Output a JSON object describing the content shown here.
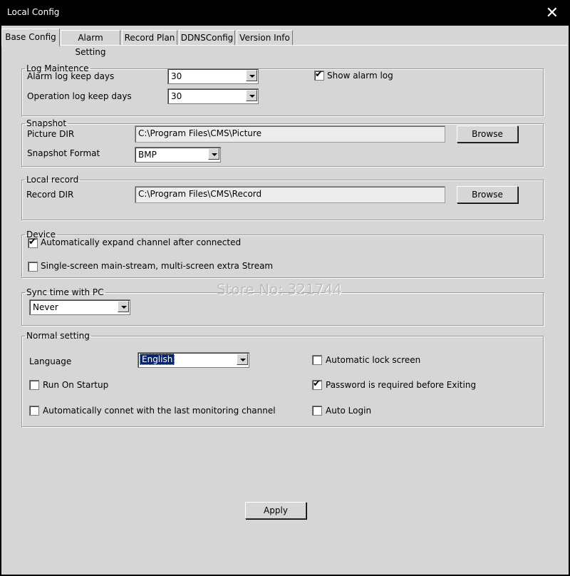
{
  "window": {
    "title": "Local Config",
    "close_label": "✕"
  },
  "tabs": [
    {
      "label": "Base Config"
    },
    {
      "label": "Alarm Setting"
    },
    {
      "label": "Record Plan"
    },
    {
      "label": "DDNSConfig"
    },
    {
      "label": "Version Info"
    }
  ],
  "log": {
    "legend": "Log Maintence",
    "alarm_days_label": "Alarm log keep days",
    "alarm_days_value": "30",
    "op_days_label": "Operation log keep days",
    "op_days_value": "30",
    "show_alarm_label": "Show alarm log",
    "show_alarm_checked": true
  },
  "snapshot": {
    "legend": "Snapshot",
    "dir_label": "Picture DIR",
    "dir_value": "C:\\Program Files\\CMS\\Picture",
    "browse_label": "Browse",
    "format_label": "Snapshot Format",
    "format_value": "BMP"
  },
  "record": {
    "legend": "Local record",
    "dir_label": "Record DIR",
    "dir_value": "C:\\Program Files\\CMS\\Record",
    "browse_label": "Browse"
  },
  "device": {
    "legend": "Device",
    "expand_label": "Automatically expand channel after connected",
    "expand_checked": true,
    "stream_label": "Single-screen main-stream, multi-screen extra Stream",
    "stream_checked": false
  },
  "sync": {
    "legend": "Sync time with PC",
    "value": "Never"
  },
  "normal": {
    "legend": "Normal setting",
    "language_label": "Language",
    "language_value": "English",
    "startup_label": "Run On Startup",
    "startup_checked": false,
    "autoconnect_label": "Automatically connet with the last monitoring channel",
    "autoconnect_checked": false,
    "lock_label": "Automatic lock screen",
    "lock_checked": false,
    "password_label": "Password is required before Exiting",
    "password_checked": true,
    "autologin_label": "Auto Login",
    "autologin_checked": false
  },
  "apply_label": "Apply",
  "watermark": "Store No: 321744"
}
